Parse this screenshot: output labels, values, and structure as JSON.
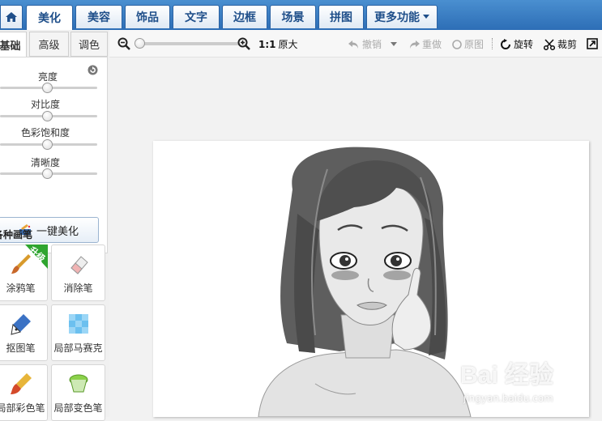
{
  "top_tabs": [
    "美化",
    "美容",
    "饰品",
    "文字",
    "边框",
    "场景",
    "拼图",
    "更多功能"
  ],
  "left_tabs": [
    "基础",
    "高级",
    "调色"
  ],
  "adjustments": [
    "亮度",
    "对比度",
    "色彩饱和度",
    "清晰度"
  ],
  "one_key_label": "一键美化",
  "brushes_section": "各种画笔",
  "upgrade_badge": "升级",
  "brushes": [
    "涂鸦笔",
    "消除笔",
    "抠图笔",
    "局部马赛克",
    "局部彩色笔",
    "局部变色笔"
  ],
  "toolbar": {
    "ratio": "1:1",
    "original_size": "原大",
    "undo": "撤销",
    "redo": "重做",
    "original": "原图",
    "rotate": "旋转",
    "crop": "裁剪"
  },
  "watermark": {
    "brand": "Bai 经验",
    "url": "jingyan.baidu.com"
  }
}
